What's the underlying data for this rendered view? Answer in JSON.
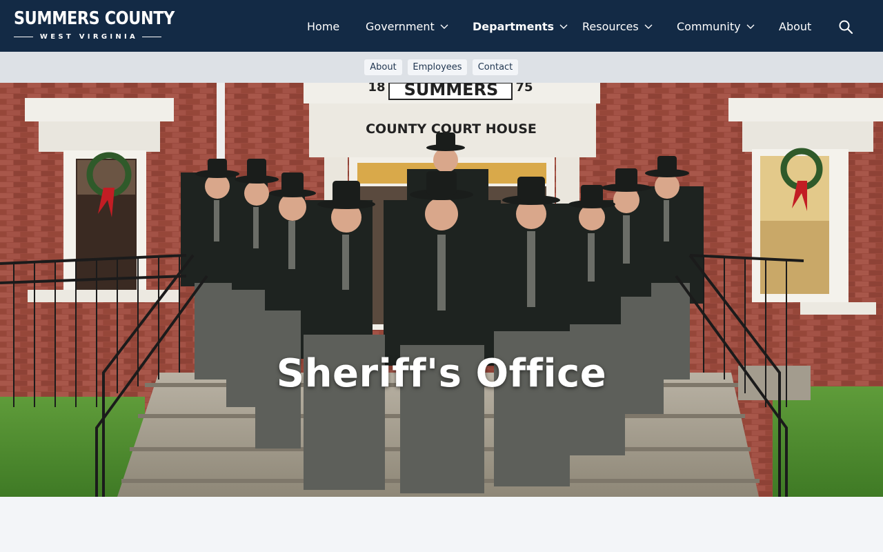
{
  "site": {
    "logo_title": "SUMMERS COUNTY",
    "logo_subtitle": "WEST VIRGINIA"
  },
  "nav": {
    "items": [
      {
        "label": "Home",
        "has_dropdown": false,
        "active": false
      },
      {
        "label": "Government",
        "has_dropdown": true,
        "active": false
      },
      {
        "label": "Departments",
        "has_dropdown": true,
        "active": true
      },
      {
        "label": "Resources",
        "has_dropdown": true,
        "active": false
      },
      {
        "label": "Community",
        "has_dropdown": true,
        "active": false
      },
      {
        "label": "About",
        "has_dropdown": false,
        "active": false
      }
    ],
    "search_icon": "search-icon"
  },
  "subnav": {
    "items": [
      {
        "label": "About"
      },
      {
        "label": "Employees"
      },
      {
        "label": "Contact"
      }
    ]
  },
  "hero": {
    "title": "Sheriff's Office",
    "image_sign_top": "SUMMERS",
    "image_sign_year_left": "18",
    "image_sign_year_right": "75",
    "image_sign_bottom": "COUNTY COURT HOUSE"
  },
  "colors": {
    "header_bg": "#132a45",
    "subbar_bg": "#dde1e6",
    "pill_bg": "#f3f5f8",
    "page_bg": "#f3f5f8"
  }
}
